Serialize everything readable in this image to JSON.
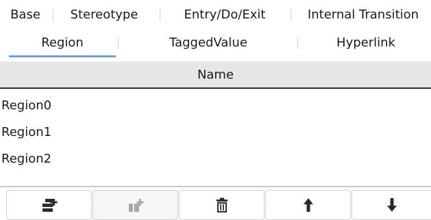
{
  "tabs_row1": [
    {
      "label": "Base"
    },
    {
      "label": "Stereotype"
    },
    {
      "label": "Entry/Do/Exit"
    },
    {
      "label": "Internal Transition"
    }
  ],
  "tabs_row2": [
    {
      "label": "Region",
      "active": true
    },
    {
      "label": "TaggedValue"
    },
    {
      "label": "Hyperlink"
    }
  ],
  "table": {
    "column_header": "Name",
    "rows": [
      "Region0",
      "Region1",
      "Region2"
    ]
  },
  "toolbar": [
    {
      "icon": "add-icon",
      "enabled": true
    },
    {
      "icon": "add-child-icon",
      "enabled": false
    },
    {
      "icon": "delete-icon",
      "enabled": true
    },
    {
      "icon": "move-up-icon",
      "enabled": true
    },
    {
      "icon": "move-down-icon",
      "enabled": true
    }
  ],
  "colors": {
    "active_tab_underline": "#6f9fd8",
    "header_background": "#e6e6e6",
    "icon_color": "#2b2b2b",
    "disabled_icon_color": "#a8a8a8"
  }
}
